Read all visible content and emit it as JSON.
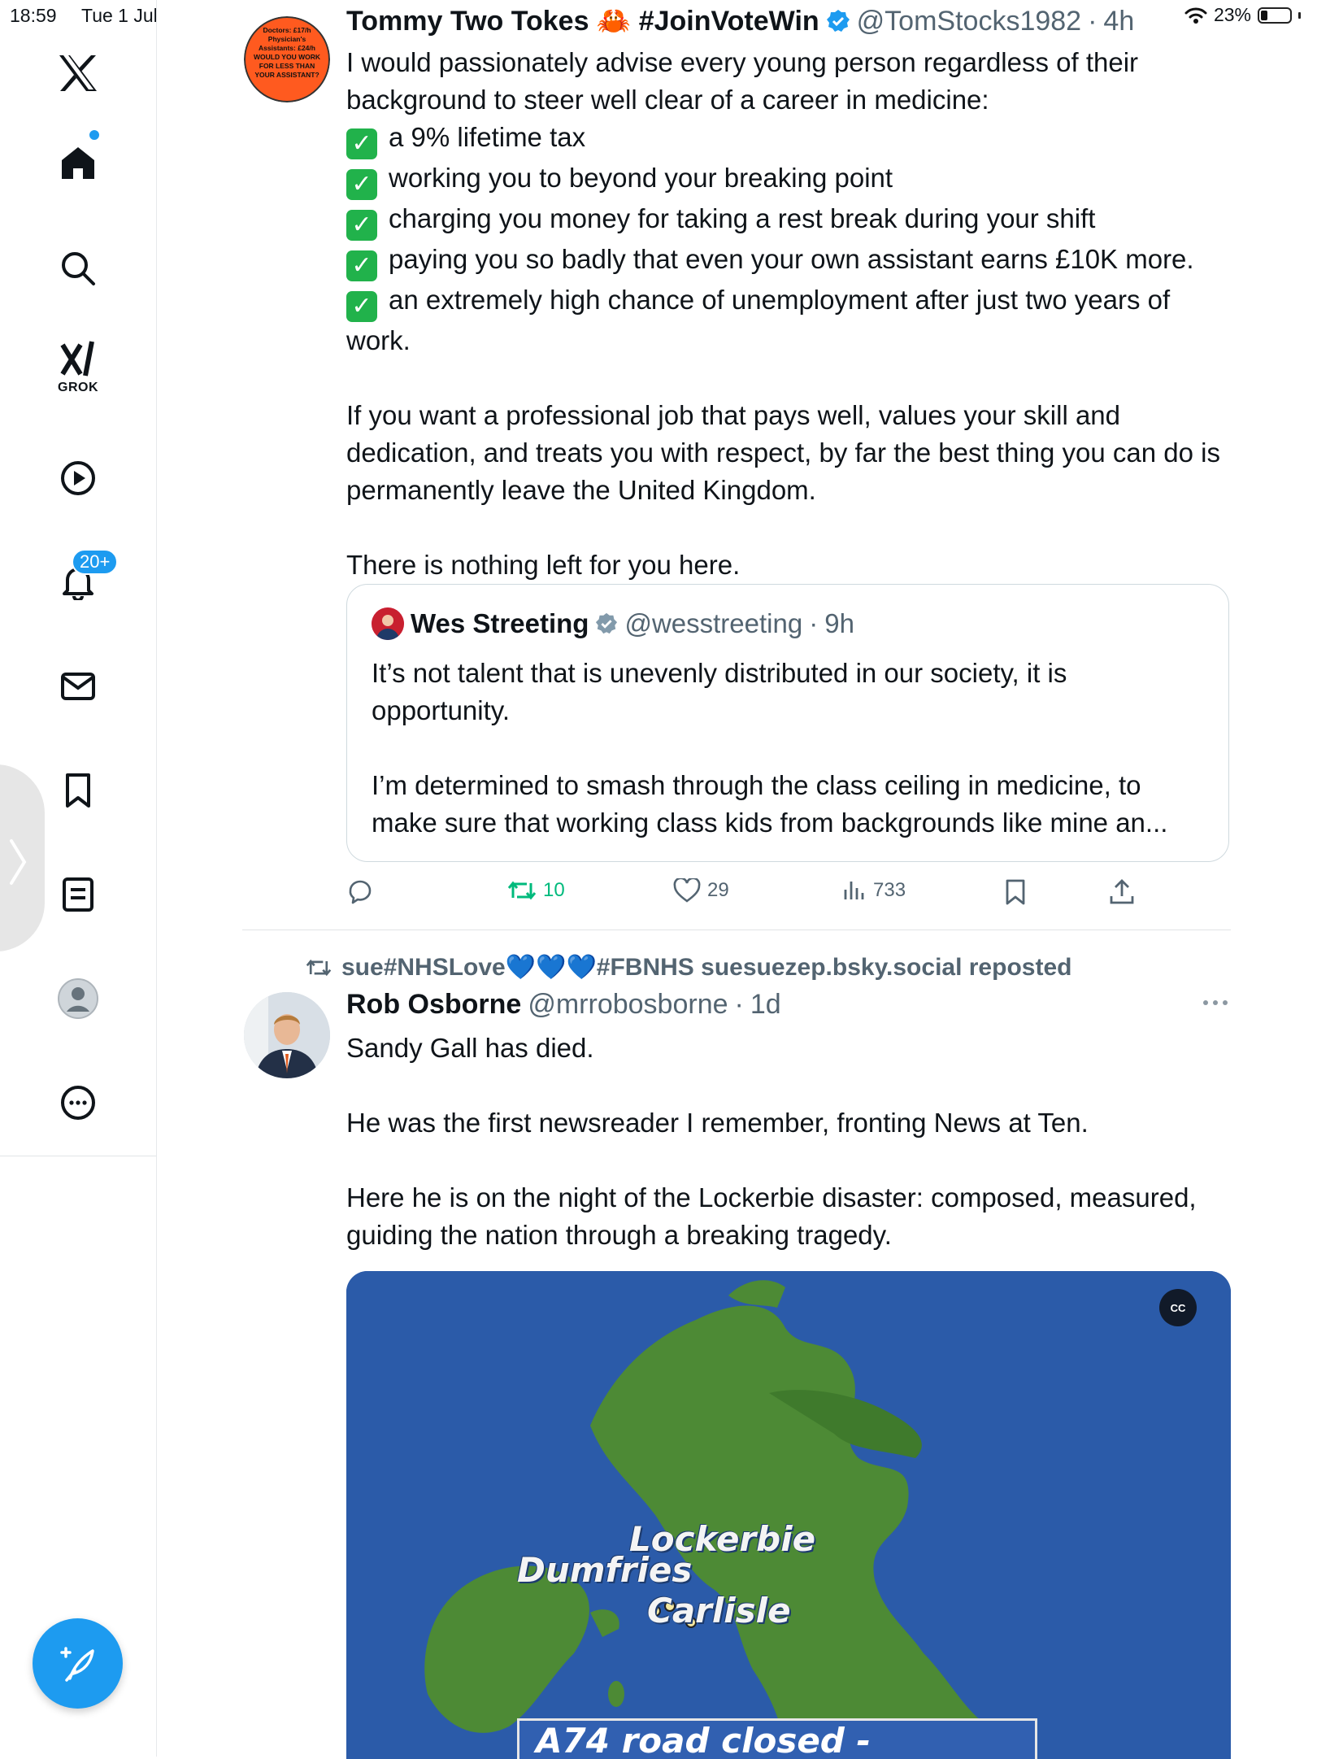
{
  "status_bar": {
    "time": "18:59",
    "date": "Tue 1 Jul",
    "battery": "23%",
    "battery_level": 0.23
  },
  "sidebar": {
    "grok_label": "GROK",
    "notifications_badge": "20+",
    "items": [
      "x-logo",
      "home-icon",
      "search-icon",
      "grok-icon",
      "video-icon",
      "notifications-icon",
      "messages-icon",
      "bookmarks-icon",
      "lists-icon",
      "profile-icon",
      "more-icon"
    ]
  },
  "tweet1": {
    "name": "Tommy Two Tokes 🦀 #JoinVoteWin",
    "handle": "@TomStocks1982",
    "time": "4h",
    "avatar_text": [
      "Doctors: £17/h",
      "Physician's",
      "Assistants: £24/h",
      "WOULD YOU WORK",
      "FOR LESS THAN",
      "YOUR ASSISTANT?"
    ],
    "intro": "I would passionately advise every young person regardless of their background to steer well clear of a career in medicine:",
    "check_mark": "✓",
    "checklist": [
      "a 9% lifetime tax",
      "working you to beyond your breaking point",
      "charging you money for taking a rest break during your shift",
      "paying you so badly that even your own assistant earns £10K more.",
      "an extremely high chance of unemployment after just two years of work."
    ],
    "para2": "If you want a professional job that pays well, values your skill and dedication, and treats you with respect, by far the best thing you can do is permanently leave the United Kingdom.",
    "para3": "There is nothing left for you here.",
    "quote": {
      "name": "Wes Streeting",
      "handle": "@wesstreeting",
      "time": "9h",
      "para1": "It’s not talent that is unevenly distributed in our society, it is opportunity.",
      "para2": "I’m determined to smash through the class ceiling in medicine, to make sure that working class kids from backgrounds like mine an..."
    },
    "actions": {
      "retweets": "10",
      "likes": "29",
      "views": "733"
    }
  },
  "tweet2": {
    "reposted_by": "sue#NHSLove💙💙💙#FBNHS suesuezep.bsky.social reposted",
    "name": "Rob Osborne",
    "handle": "@mrrobosborne",
    "time": "1d",
    "para1": "Sandy Gall has died.",
    "para2": "He was the first newsreader I remember, fronting News at Ten.",
    "para3": "Here he is on the night of the Lockerbie disaster: composed, measured, guiding the nation through a breaking tragedy.",
    "media": {
      "cc_label": "CC",
      "labels": {
        "lockerbie": "Lockerbie",
        "dumfries": "Dumfries",
        "carlisle": "Carlisle"
      },
      "caption": "A74 road closed -"
    }
  },
  "colors": {
    "accent": "#1d9bf0",
    "retweet_green": "#00ba7c",
    "text_secondary": "#536471",
    "check_green": "#21b24b"
  }
}
